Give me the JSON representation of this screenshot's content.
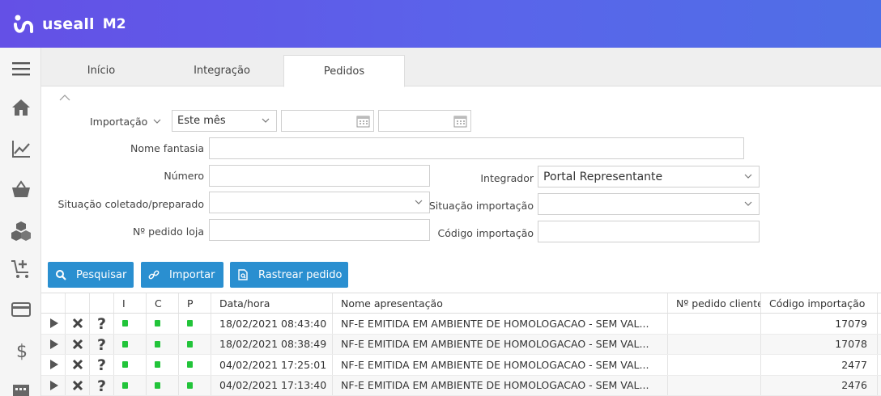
{
  "app": {
    "brand": "useall",
    "version": "M2"
  },
  "tabs": [
    {
      "label": "Início",
      "active": false
    },
    {
      "label": "Integração",
      "active": false
    },
    {
      "label": "Pedidos",
      "active": true
    }
  ],
  "sidebar": {
    "icons": [
      "menu-icon",
      "home-icon",
      "chart-line-icon",
      "basket-icon",
      "boxes-icon",
      "cart-add-icon",
      "credit-card-icon",
      "dollar-icon",
      "calculator-icon"
    ]
  },
  "filters": {
    "importacao_label": "Importação",
    "periodo_value": "Este mês",
    "data_inicio_value": "",
    "data_fim_value": "",
    "nome_fantasia_label": "Nome fantasia",
    "nome_fantasia_value": "",
    "numero_label": "Número",
    "numero_value": "",
    "integrador_label": "Integrador",
    "integrador_value": "Portal Representante",
    "situacao_coletado_label": "Situação coletado/preparado",
    "situacao_coletado_value": "",
    "situacao_importacao_label": "Situação importação",
    "situacao_importacao_value": "",
    "pedido_loja_label": "Nº pedido loja",
    "pedido_loja_value": "",
    "codigo_importacao_label": "Código importação",
    "codigo_importacao_value": ""
  },
  "actions": {
    "pesquisar": "Pesquisar",
    "importar": "Importar",
    "rastrear": "Rastrear pedido"
  },
  "grid": {
    "columns": [
      "I",
      "C",
      "P",
      "Data/hora",
      "Nome apresentação",
      "Nº pedido cliente",
      "Código importação"
    ],
    "rows": [
      {
        "data_hora": "18/02/2021 08:43:40",
        "nome": "NF-E EMITIDA EM AMBIENTE DE HOMOLOGACAO - SEM VAL...",
        "pedido_cliente": "",
        "codigo": "17079"
      },
      {
        "data_hora": "18/02/2021 08:38:49",
        "nome": "NF-E EMITIDA EM AMBIENTE DE HOMOLOGACAO - SEM VAL...",
        "pedido_cliente": "",
        "codigo": "17078"
      },
      {
        "data_hora": "04/02/2021 17:25:01",
        "nome": "NF-E EMITIDA EM AMBIENTE DE HOMOLOGACAO - SEM VAL...",
        "pedido_cliente": "",
        "codigo": "2477"
      },
      {
        "data_hora": "04/02/2021 17:13:40",
        "nome": "NF-E EMITIDA EM AMBIENTE DE HOMOLOGACAO - SEM VAL...",
        "pedido_cliente": "",
        "codigo": "2476"
      }
    ]
  },
  "colors": {
    "header_start": "#6450e6",
    "header_end": "#4f6fe6",
    "button": "#2a8fd0",
    "status_ok": "#22c43a"
  }
}
